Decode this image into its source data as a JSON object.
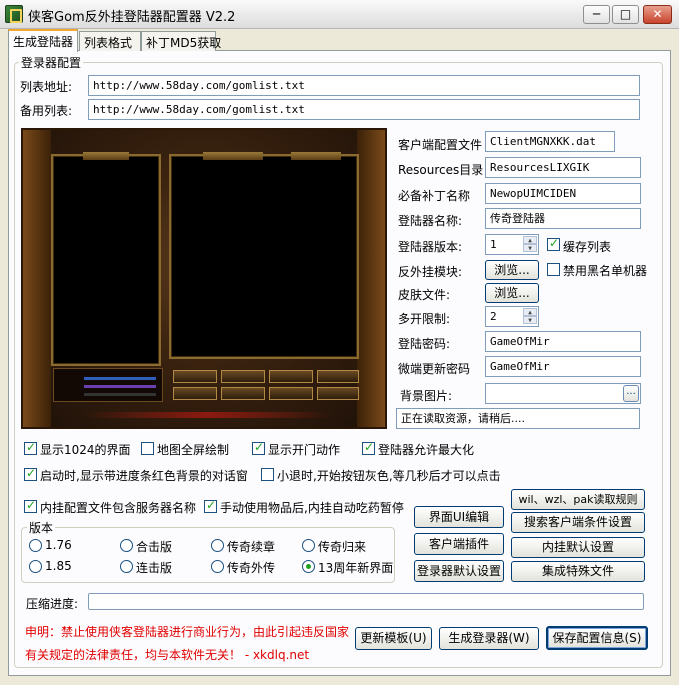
{
  "window": {
    "title": "侠客Gom反外挂登陆器配置器 V2.2",
    "min_symbol": "─",
    "max_symbol": "□",
    "close_symbol": "✕"
  },
  "tabs": [
    "生成登陆器",
    "列表格式",
    "补丁MD5获取"
  ],
  "config_group": {
    "legend": "登录器配置",
    "list_address_label": "列表地址:",
    "list_address_value": "http://www.58day.com/gomlist.txt",
    "backup_list_label": "备用列表:",
    "backup_list_value": "http://www.58day.com/gomlist.txt"
  },
  "right_form": {
    "client_config_label": "客户端配置文件",
    "client_config_value": "ClientMGNXKK.dat",
    "resources_label": "Resources目录",
    "resources_value": "ResourcesLIXGIK",
    "patch_label": "必备补丁名称",
    "patch_value": "NewopUIMCIDEN",
    "launcher_name_label": "登陆器名称:",
    "launcher_name_value": "传奇登陆器",
    "version_label": "登陆器版本:",
    "version_value": "1",
    "cache_list_label": "缓存列表",
    "cache_list_checked": true,
    "anticheat_label": "反外挂模块:",
    "browse_label": "浏览...",
    "blacklist_label": "禁用黑名单机器",
    "blacklist_checked": false,
    "skin_label": "皮肤文件:",
    "skin_browse_label": "浏览...",
    "multi_open_label": "多开限制:",
    "multi_open_value": "2",
    "launcher_pwd_label": "登陆密码:",
    "launcher_pwd_value": "GameOfMir",
    "micro_pwd_label": "微端更新密码",
    "micro_pwd_value": "GameOfMir",
    "bg_image_label": "背景图片:",
    "bg_image_value": "",
    "bg_browse_label": "...",
    "status_text": "正在读取资源，请稍后...."
  },
  "options": {
    "show_1024": {
      "label": "显示1024的界面",
      "checked": true
    },
    "map_fullscreen": {
      "label": "地图全屏绘制",
      "checked": false
    },
    "show_door_anim": {
      "label": "显示开门动作",
      "checked": true
    },
    "allow_maximize": {
      "label": "登陆器允许最大化",
      "checked": true
    },
    "startup_dialog": {
      "label": "启动时,显示带进度条红色背景的对话窗",
      "checked": true
    },
    "minimize_gray": {
      "label": "小退时,开始按钮灰色,等几秒后才可以点击",
      "checked": false
    },
    "include_server_name": {
      "label": "内挂配置文件包含服务器名称",
      "checked": true
    },
    "auto_eat_pause": {
      "label": "手动使用物品后,内挂自动吃药暂停",
      "checked": true
    }
  },
  "version_group": {
    "legend": "版本",
    "items": [
      {
        "label": "1.76",
        "checked": false
      },
      {
        "label": "合击版",
        "checked": false
      },
      {
        "label": "传奇续章",
        "checked": false
      },
      {
        "label": "传奇归来",
        "checked": false
      },
      {
        "label": "1.85",
        "checked": false
      },
      {
        "label": "连击版",
        "checked": false
      },
      {
        "label": "传奇外传",
        "checked": false
      },
      {
        "label": "13周年新界面",
        "checked": true
      }
    ]
  },
  "side_buttons": {
    "ui_edit": "界面UI编辑",
    "client_plugin": "客户端插件",
    "launcher_default": "登录器默认设置",
    "read_rules": "wil、wzl、pak读取规则",
    "search_client": "搜索客户端条件设置",
    "plugin_default": "内挂默认设置",
    "integrate_files": "集成特殊文件"
  },
  "progress": {
    "label": "压缩进度:",
    "value": 0
  },
  "notice": {
    "line1": "申明：禁止使用侠客登陆器进行商业行为，由此引起违反国家",
    "line2": "有关规定的法律责任，均与本软件无关！ -  xkdlq.net"
  },
  "bottom_buttons": {
    "update_template": "更新模板(U)",
    "generate": "生成登录器(W)",
    "save_config": "保存配置信息(S)"
  },
  "preview_buttons": [
    "开始游戏",
    "新建账号",
    "修改密码",
    "退出游戏",
    "账号注册",
    "游戏充值",
    "找回密码",
    "游戏官网"
  ]
}
